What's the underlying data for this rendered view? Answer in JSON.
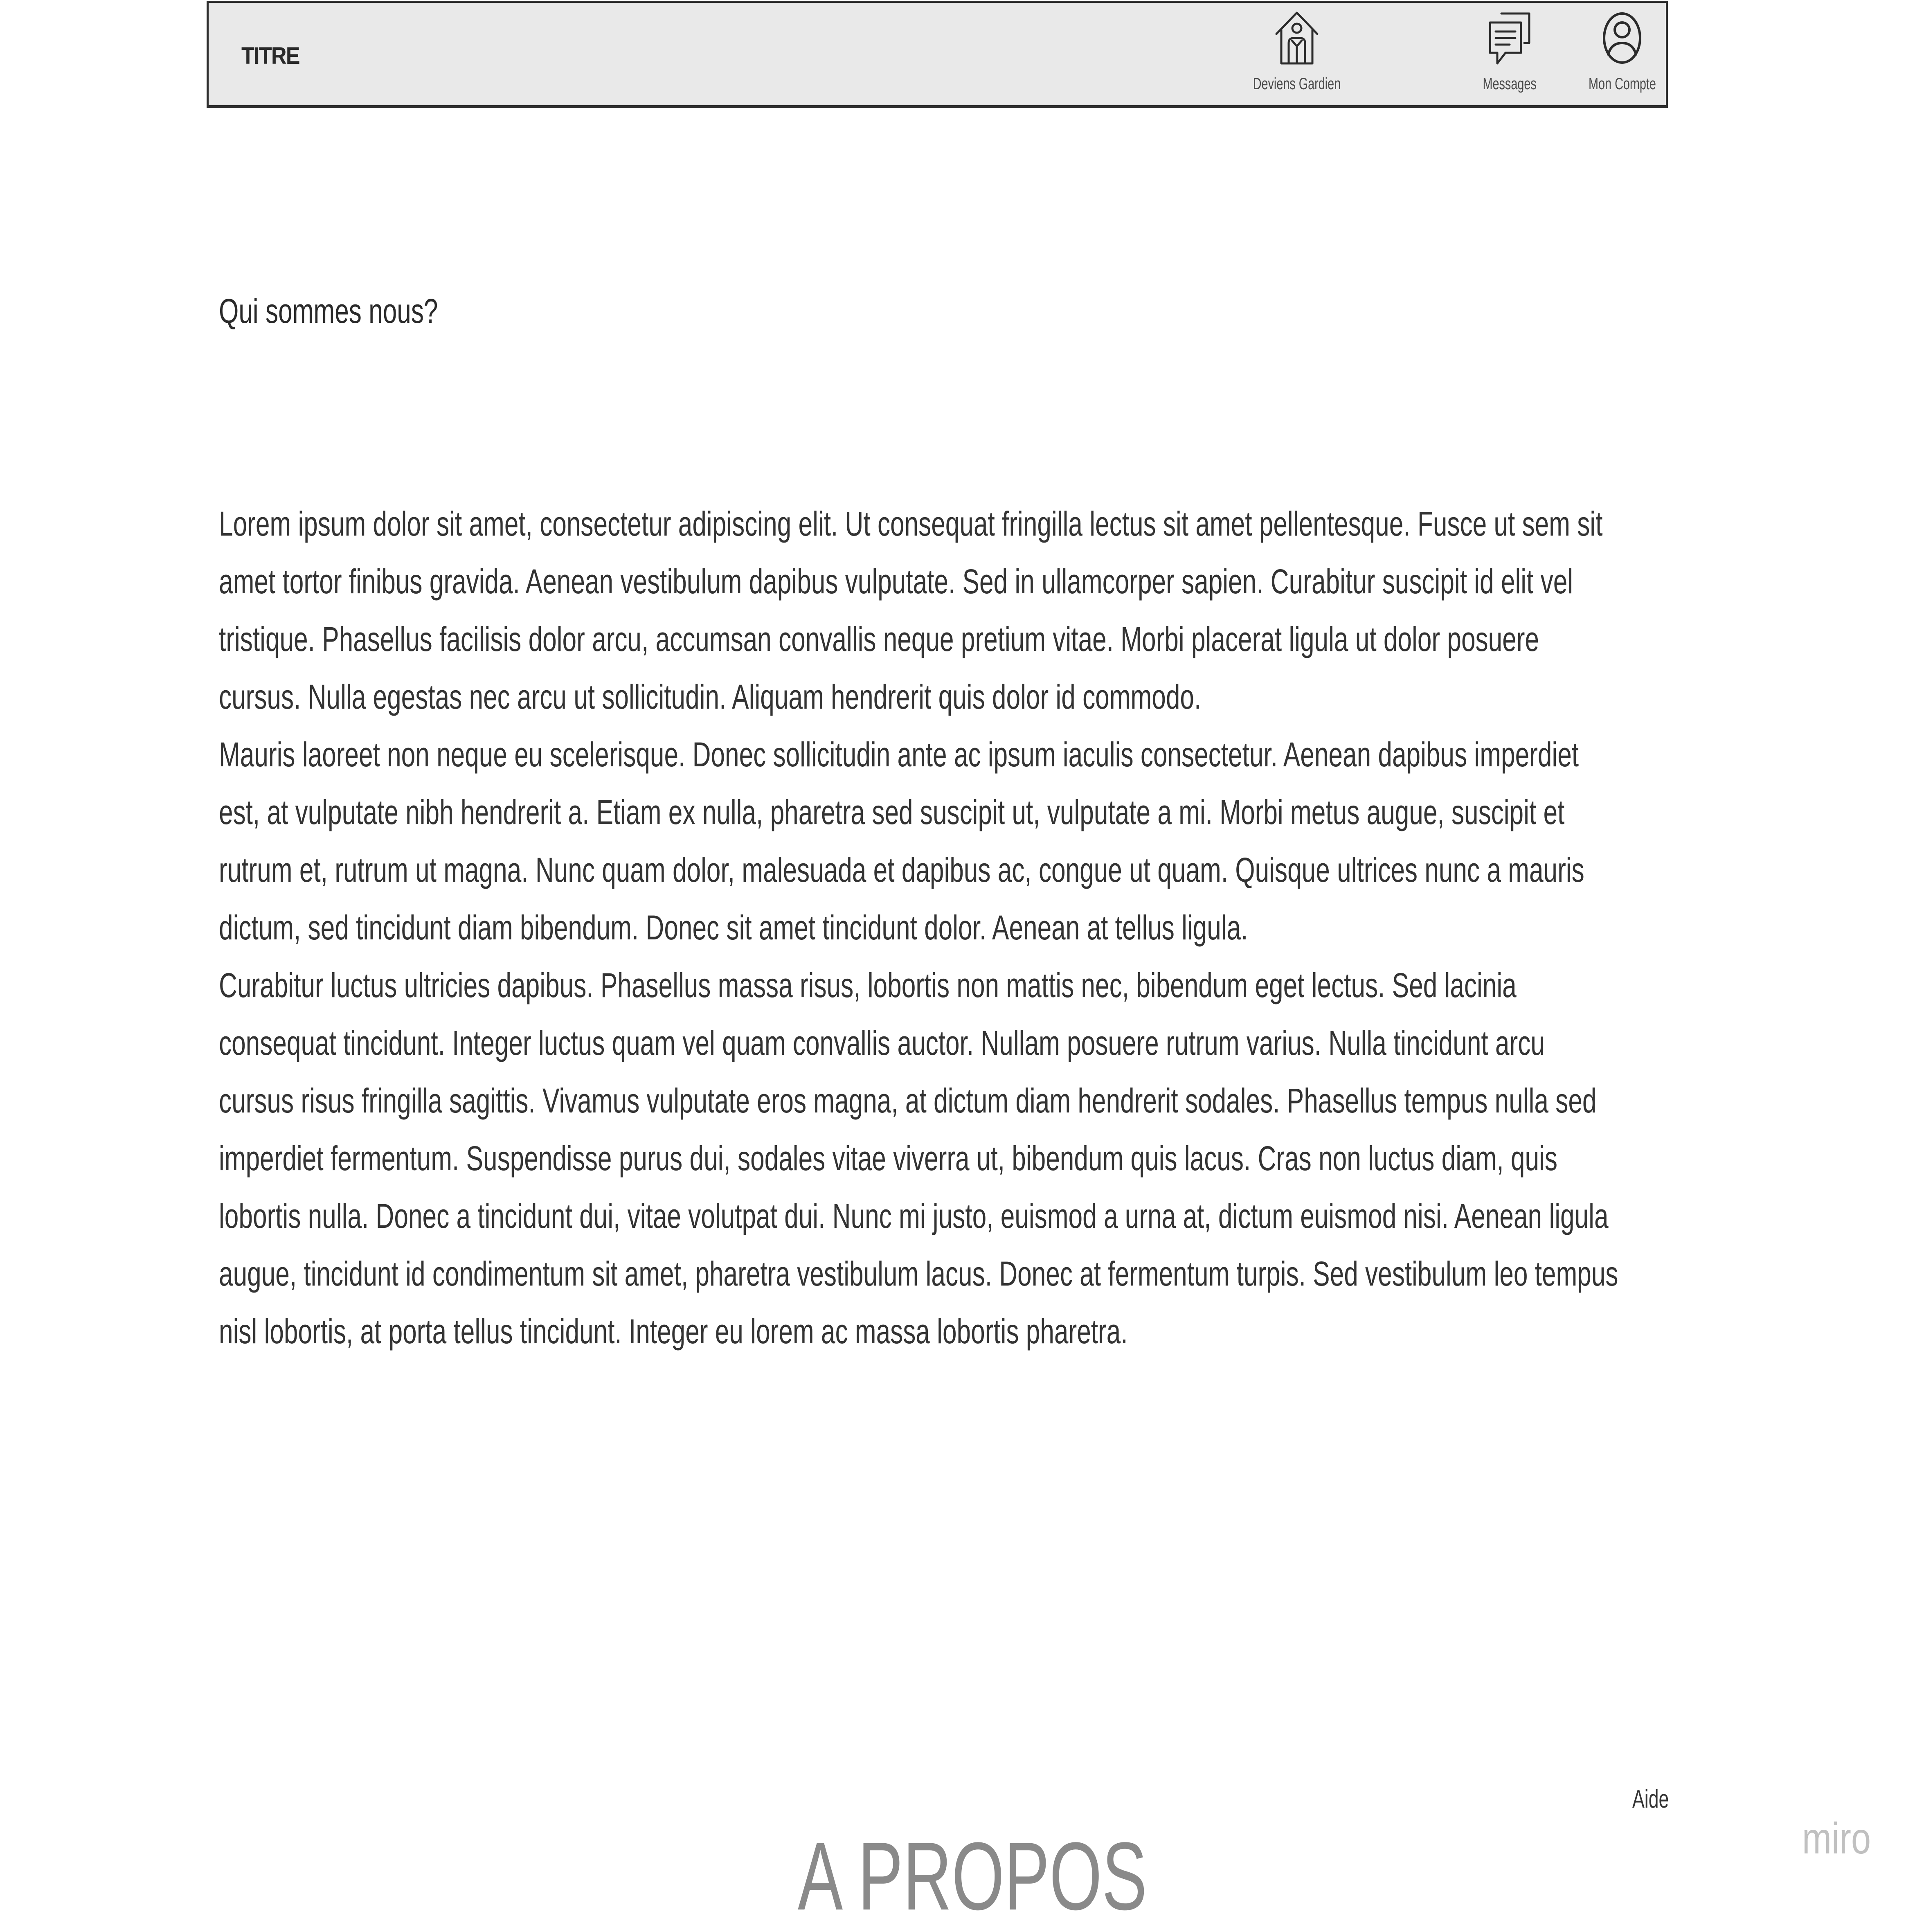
{
  "header": {
    "title": "TITRE",
    "nav": [
      {
        "label": "Deviens Gardien",
        "icon": "house-person-icon"
      },
      {
        "label": "Messages",
        "icon": "chat-bubbles-icon"
      },
      {
        "label": "Mon Compte",
        "icon": "user-circle-icon"
      }
    ]
  },
  "main": {
    "heading": "Qui sommes nous?",
    "paragraphs": [
      "Lorem ipsum dolor sit amet, consectetur adipiscing elit. Ut consequat fringilla lectus sit amet pellentesque. Fusce ut sem sit amet tortor finibus gravida. Aenean vestibulum dapibus vulputate. Sed in ullamcorper sapien. Curabitur suscipit id elit vel tristique. Phasellus facilisis dolor arcu, accumsan convallis neque pretium vitae. Morbi placerat ligula ut dolor posuere cursus. Nulla egestas nec arcu ut sollicitudin. Aliquam hendrerit quis dolor id commodo.",
      "Mauris laoreet non neque eu scelerisque. Donec sollicitudin ante ac ipsum iaculis consectetur. Aenean dapibus imperdiet est, at vulputate nibh hendrerit a. Etiam ex nulla, pharetra sed suscipit ut, vulputate a mi. Morbi metus augue, suscipit et rutrum et, rutrum ut magna. Nunc quam dolor, malesuada et dapibus ac, congue ut quam. Quisque ultrices nunc a mauris dictum, sed tincidunt diam bibendum. Donec sit amet tincidunt dolor. Aenean at tellus ligula.",
      "Curabitur luctus ultricies dapibus. Phasellus massa risus, lobortis non mattis nec, bibendum eget lectus. Sed lacinia consequat tincidunt. Integer luctus quam vel quam convallis auctor. Nullam posuere rutrum varius. Nulla tincidunt arcu cursus risus fringilla sagittis. Vivamus vulputate eros magna, at dictum diam hendrerit sodales. Phasellus tempus nulla sed imperdiet fermentum. Suspendisse purus dui, sodales vitae viverra ut, bibendum quis lacus. Cras non luctus diam, quis lobortis nulla. Donec a tincidunt dui, vitae volutpat dui. Nunc mi justo, euismod a urna at, dictum euismod nisi. Aenean ligula augue, tincidunt id condimentum sit amet, pharetra vestibulum lacus. Donec at fermentum turpis. Sed vestibulum leo tempus nisl lobortis, at porta tellus tincidunt. Integer eu lorem ac massa lobortis pharetra."
    ]
  },
  "footer": {
    "help_label": "Aide",
    "page_label": "A PROPOS"
  },
  "watermark": "miro",
  "colors": {
    "header_bg": "#e9e9e9",
    "header_border": "#2e2e2e",
    "text": "#333333",
    "page_label": "#8a8a8a",
    "watermark": "#c0c0c0"
  }
}
